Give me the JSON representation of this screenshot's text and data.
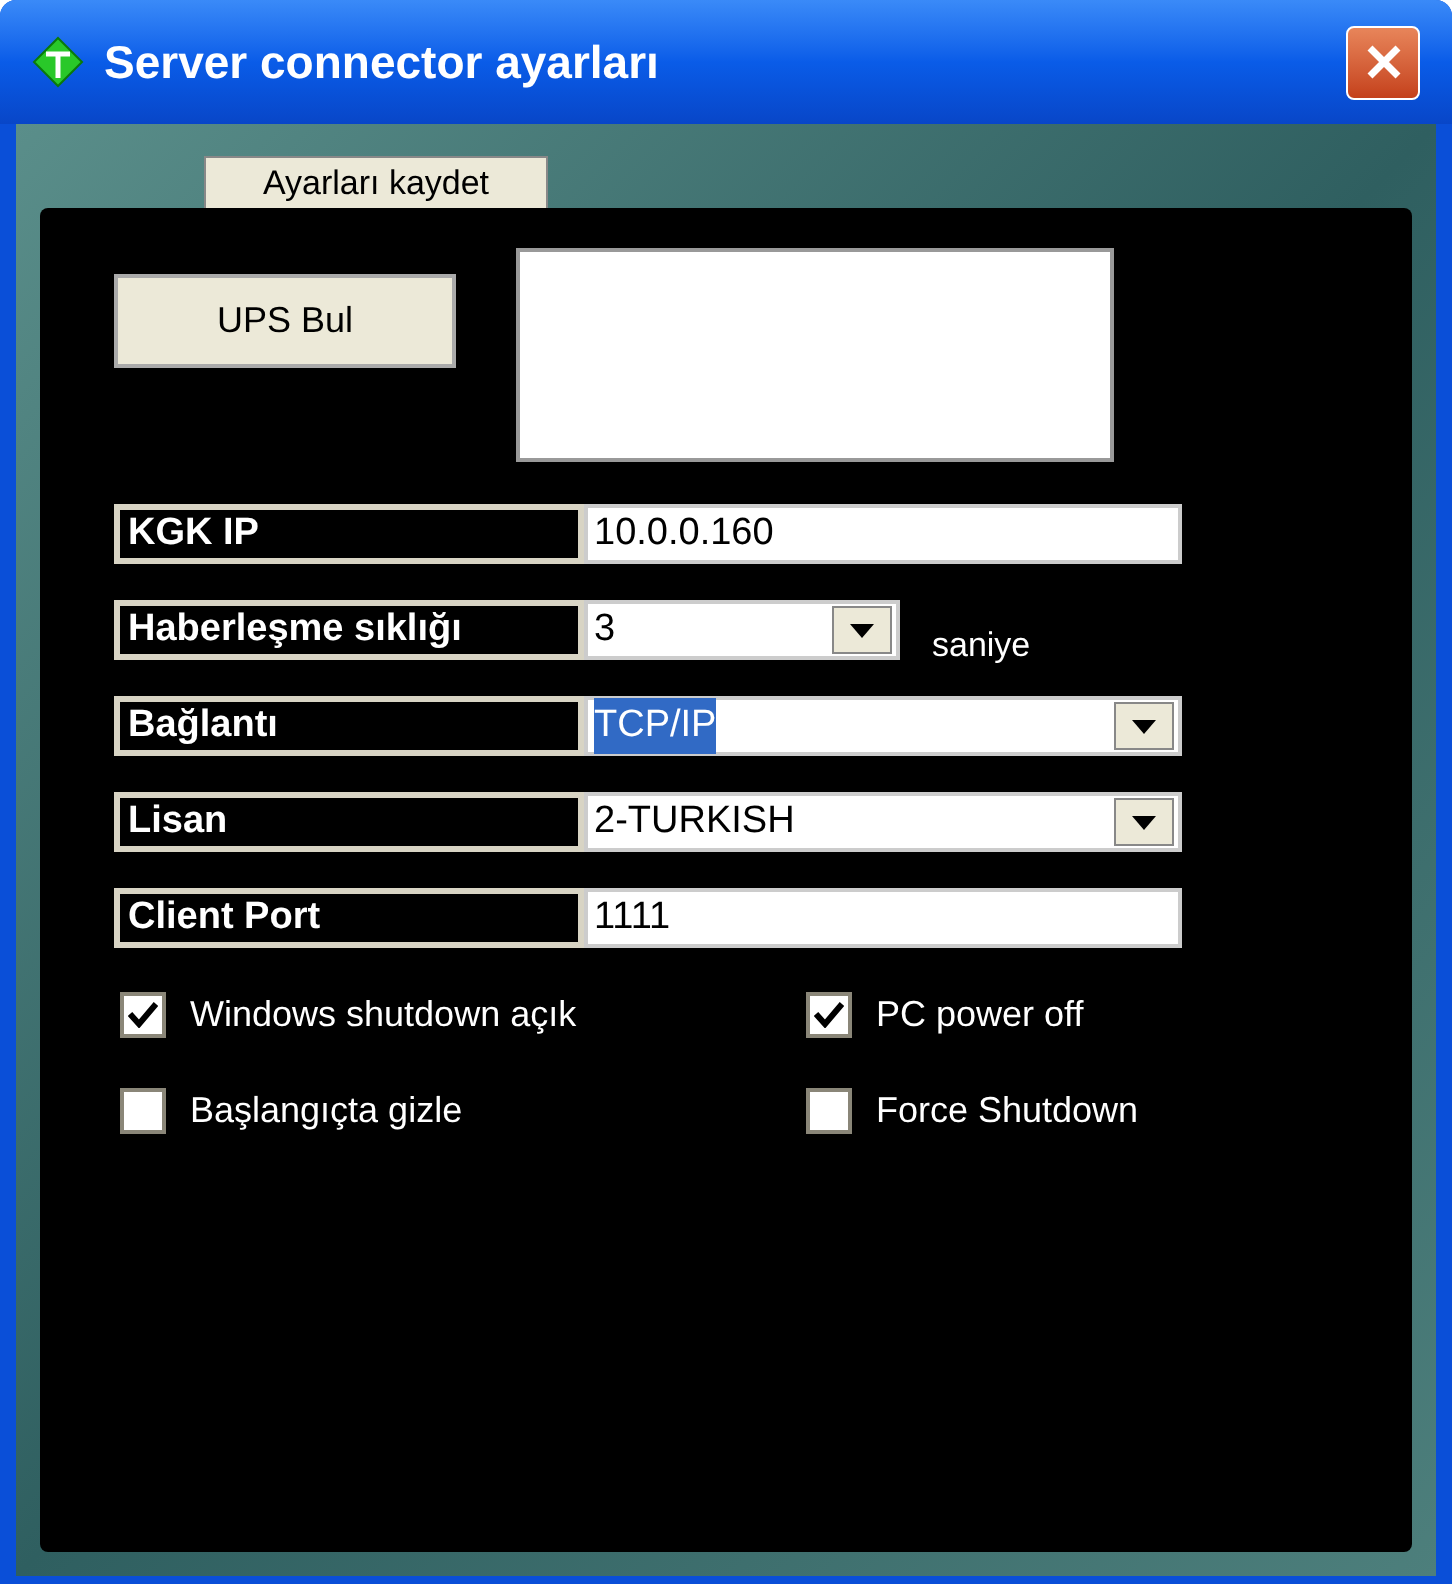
{
  "window": {
    "title": "Server connector ayarları"
  },
  "save_button": "Ayarları kaydet",
  "find_button": "UPS Bul",
  "fields": [
    {
      "label": "KGK IP",
      "kind": "text",
      "value": "10.0.0.160"
    },
    {
      "label": "Haberleşme sıklığı",
      "kind": "short-combo",
      "value": "3",
      "unit": "saniye"
    },
    {
      "label": "Bağlantı",
      "kind": "combo",
      "value": "TCP/IP",
      "highlighted": true
    },
    {
      "label": "Lisan",
      "kind": "combo",
      "value": "2-TURKISH",
      "highlighted": false
    },
    {
      "label": "Client Port",
      "kind": "text",
      "value": "1111"
    }
  ],
  "checkboxes": [
    {
      "label": "Windows shutdown açık",
      "checked": true
    },
    {
      "label": "PC power off",
      "checked": true
    },
    {
      "label": "Başlangıçta gizle",
      "checked": false
    },
    {
      "label": "Force Shutdown",
      "checked": false
    }
  ]
}
